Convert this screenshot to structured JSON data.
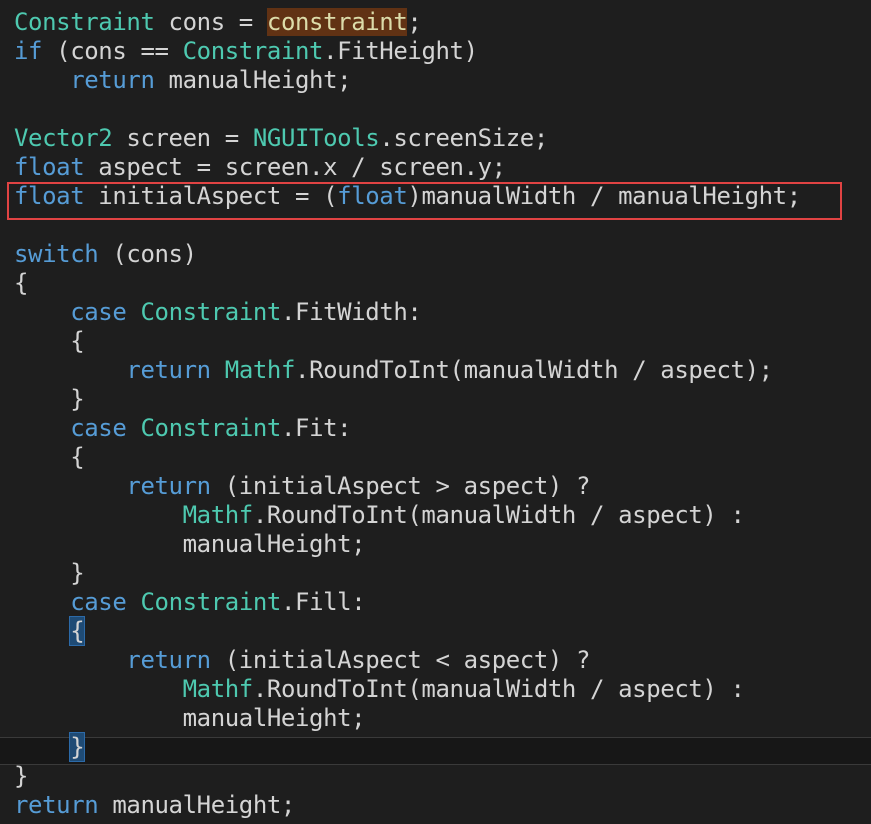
{
  "editor": {
    "lines": [
      {
        "tokens": [
          {
            "text": "Constraint",
            "role": "type-name"
          },
          {
            "text": " cons = ",
            "role": "plain"
          },
          {
            "text": "constraint",
            "role": "highlight"
          },
          {
            "text": ";",
            "role": "plain"
          }
        ]
      },
      {
        "tokens": [
          {
            "text": "if",
            "role": "keyword"
          },
          {
            "text": " (cons == ",
            "role": "plain"
          },
          {
            "text": "Constraint",
            "role": "type-name"
          },
          {
            "text": ".FitHeight)",
            "role": "plain"
          }
        ]
      },
      {
        "tokens": [
          {
            "text": "    ",
            "role": "plain"
          },
          {
            "text": "return",
            "role": "keyword"
          },
          {
            "text": " manualHeight;",
            "role": "plain"
          }
        ]
      },
      {
        "tokens": []
      },
      {
        "tokens": [
          {
            "text": "Vector2",
            "role": "type-name"
          },
          {
            "text": " screen = ",
            "role": "plain"
          },
          {
            "text": "NGUITools",
            "role": "type-name"
          },
          {
            "text": ".screenSize;",
            "role": "plain"
          }
        ]
      },
      {
        "tokens": [
          {
            "text": "float",
            "role": "keyword"
          },
          {
            "text": " aspect = screen.x / screen.y;",
            "role": "plain"
          }
        ]
      },
      {
        "tokens": [
          {
            "text": "float",
            "role": "keyword"
          },
          {
            "text": " initialAspect = (",
            "role": "plain"
          },
          {
            "text": "float",
            "role": "keyword"
          },
          {
            "text": ")manualWidth / manualHeight;",
            "role": "plain"
          }
        ]
      },
      {
        "tokens": []
      },
      {
        "tokens": [
          {
            "text": "switch",
            "role": "keyword"
          },
          {
            "text": " (cons)",
            "role": "plain"
          }
        ]
      },
      {
        "tokens": [
          {
            "text": "{",
            "role": "plain"
          }
        ]
      },
      {
        "tokens": [
          {
            "text": "    ",
            "role": "plain"
          },
          {
            "text": "case",
            "role": "keyword"
          },
          {
            "text": " ",
            "role": "plain"
          },
          {
            "text": "Constraint",
            "role": "type-name"
          },
          {
            "text": ".FitWidth:",
            "role": "plain"
          }
        ]
      },
      {
        "tokens": [
          {
            "text": "    {",
            "role": "plain"
          }
        ]
      },
      {
        "tokens": [
          {
            "text": "        ",
            "role": "plain"
          },
          {
            "text": "return",
            "role": "keyword"
          },
          {
            "text": " ",
            "role": "plain"
          },
          {
            "text": "Mathf",
            "role": "type-name"
          },
          {
            "text": ".RoundToInt(manualWidth / aspect);",
            "role": "plain"
          }
        ]
      },
      {
        "tokens": [
          {
            "text": "    }",
            "role": "plain"
          }
        ]
      },
      {
        "tokens": [
          {
            "text": "    ",
            "role": "plain"
          },
          {
            "text": "case",
            "role": "keyword"
          },
          {
            "text": " ",
            "role": "plain"
          },
          {
            "text": "Constraint",
            "role": "type-name"
          },
          {
            "text": ".Fit:",
            "role": "plain"
          }
        ]
      },
      {
        "tokens": [
          {
            "text": "    {",
            "role": "plain"
          }
        ]
      },
      {
        "tokens": [
          {
            "text": "        ",
            "role": "plain"
          },
          {
            "text": "return",
            "role": "keyword"
          },
          {
            "text": " (initialAspect > aspect) ?",
            "role": "plain"
          }
        ]
      },
      {
        "tokens": [
          {
            "text": "            ",
            "role": "plain"
          },
          {
            "text": "Mathf",
            "role": "type-name"
          },
          {
            "text": ".RoundToInt(manualWidth / aspect) :",
            "role": "plain"
          }
        ]
      },
      {
        "tokens": [
          {
            "text": "            manualHeight;",
            "role": "plain"
          }
        ]
      },
      {
        "tokens": [
          {
            "text": "    }",
            "role": "plain"
          }
        ]
      },
      {
        "tokens": [
          {
            "text": "    ",
            "role": "plain"
          },
          {
            "text": "case",
            "role": "keyword"
          },
          {
            "text": " ",
            "role": "plain"
          },
          {
            "text": "Constraint",
            "role": "type-name"
          },
          {
            "text": ".Fill:",
            "role": "plain"
          }
        ]
      },
      {
        "tokens": [
          {
            "text": "    ",
            "role": "plain"
          },
          {
            "text": "{",
            "role": "bracket-match"
          }
        ]
      },
      {
        "tokens": [
          {
            "text": "        ",
            "role": "plain"
          },
          {
            "text": "return",
            "role": "keyword"
          },
          {
            "text": " (initialAspect < aspect) ?",
            "role": "plain"
          }
        ]
      },
      {
        "tokens": [
          {
            "text": "            ",
            "role": "plain"
          },
          {
            "text": "Mathf",
            "role": "type-name"
          },
          {
            "text": ".RoundToInt(manualWidth / aspect) :",
            "role": "plain"
          }
        ]
      },
      {
        "tokens": [
          {
            "text": "            manualHeight;",
            "role": "plain"
          }
        ]
      },
      {
        "tokens": [
          {
            "text": "    ",
            "role": "plain"
          },
          {
            "text": "}",
            "role": "bracket-match"
          }
        ]
      },
      {
        "tokens": [
          {
            "text": "}",
            "role": "plain"
          }
        ]
      },
      {
        "tokens": [
          {
            "text": "return",
            "role": "keyword"
          },
          {
            "text": " manualHeight;",
            "role": "plain"
          }
        ]
      }
    ],
    "current_line": 25,
    "boxed_line": 6
  },
  "theme": {
    "background": "#1e1e1e",
    "keyword": "#569cd6",
    "type-name": "#4ec9b0",
    "plain": "#d4d4d4",
    "highlight_bg": "#613214",
    "highlight_fg": "#dcdcaa",
    "bracket_match_bg": "#1f4b75",
    "annotation_box": "#e04343"
  }
}
